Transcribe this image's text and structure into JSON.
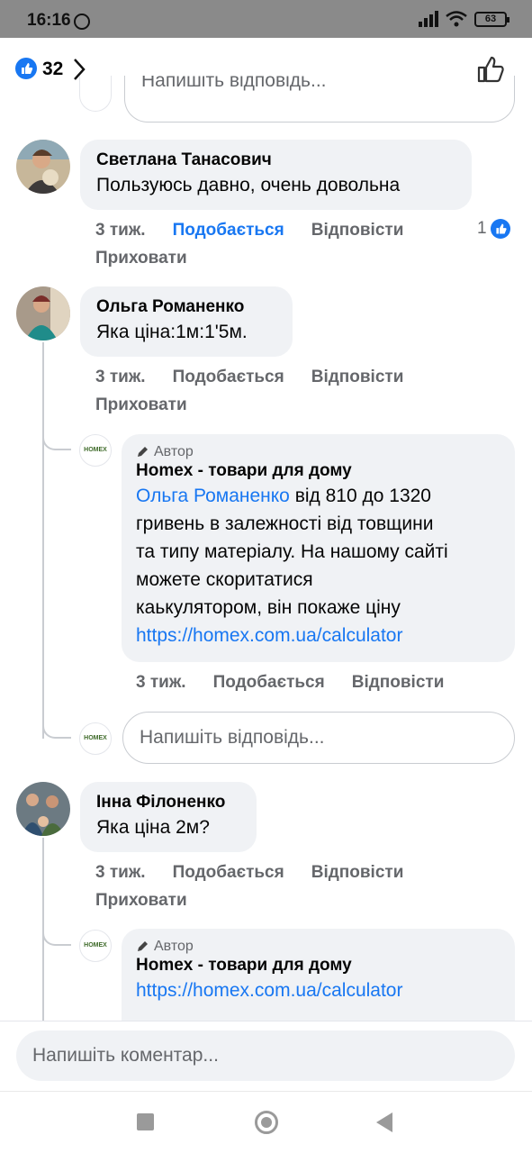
{
  "status_bar": {
    "time": "16:16",
    "battery": "63"
  },
  "header": {
    "reaction_count": "32"
  },
  "top_reply_placeholder": "Напишіть відповідь...",
  "comments": [
    {
      "author": "Светлана Танасович",
      "text": "Пользуюсь давно, очень довольна",
      "time": "3 тиж.",
      "like": "Подобається",
      "reply": "Відповісти",
      "hide": "Приховати",
      "reactions": "1"
    },
    {
      "author": "Ольга Романенко",
      "text": "Яка ціна:1м:1'5м.",
      "time": "3 тиж.",
      "like": "Подобається",
      "reply": "Відповісти",
      "hide": "Приховати"
    },
    {
      "author": "Інна Філоненко",
      "text": "Яка ціна 2м?",
      "time": "3 тиж.",
      "like": "Подобається",
      "reply": "Відповісти",
      "hide": "Приховати"
    }
  ],
  "reply1": {
    "author_tag": "Автор",
    "author": "Homex - товари для дому",
    "mention": "Ольга Романенко",
    "line1_rest": " від 810 до 1320",
    "line2": "гривень в залежності від товщини",
    "line3": "та типу матеріалу. На нашому сайті",
    "line4": "можете скоритатися",
    "line5": "каькулятором, він покаже ціну",
    "link": "https://homex.com.ua/calculator",
    "time": "3 тиж.",
    "like": "Подобається",
    "reply": "Відповісти"
  },
  "reply_input_placeholder": "Напишіть відповідь...",
  "reply2": {
    "author_tag": "Автор",
    "author": "Homex - товари для дому",
    "link": "https://homex.com.ua/calculator"
  },
  "page_avatar_label": "HOMEX",
  "composer_placeholder": "Напишіть коментар...",
  "colors": {
    "accent": "#1877f2",
    "bubble": "#f0f2f5",
    "muted": "#65676b"
  },
  "icons": [
    "alarm-icon",
    "signal-icon",
    "wifi-icon",
    "battery-icon",
    "like-icon",
    "chevron-right-icon",
    "thumbs-up-outline-icon",
    "pencil-icon",
    "nav-recents-icon",
    "nav-home-icon",
    "nav-back-icon"
  ]
}
